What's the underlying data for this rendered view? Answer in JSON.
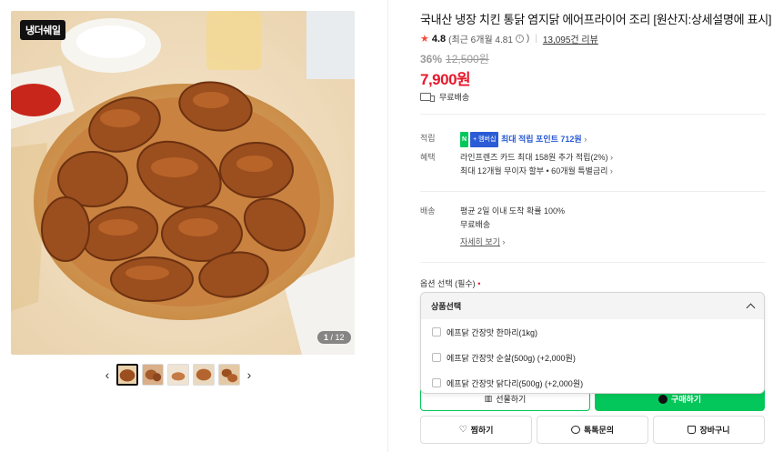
{
  "gallery": {
    "brand_badge": "냉더쉐일",
    "counter_current": "1",
    "counter_total": "12",
    "counter_separator": " / "
  },
  "product": {
    "title": "국내산 냉장 치킨 통닭 염지닭 에어프라이어 조리 [원산지:상세설명에 표시]",
    "rating": "4.8",
    "rating_sub": "(최근 6개월 4.81",
    "review_count": "13,095건 리뷰",
    "discount_rate": "36%",
    "original_price": "12,500원",
    "sale_price": "7,900원",
    "shipping_label": "무료배송"
  },
  "benefits": {
    "points_label": "적립",
    "npay_n": "N",
    "npay_plus": "+ 멤버십",
    "points_text": "최대 적립 포인트 712원",
    "benefit_label": "혜택",
    "benefit_line1": "라인프렌즈 카드 최대 158원 추가 적립(2%)",
    "benefit_line2": "최대 12개월 무이자 할부 • 60개월 특별금리",
    "delivery_label": "배송",
    "delivery_line1": "평균 2일 이내 도착 확률 100%",
    "delivery_line2": "무료배송",
    "detail_link": "자세히 보기"
  },
  "options": {
    "label": "옵션 선택 (필수)",
    "required_mark": "•",
    "dropdown_header": "상품선택",
    "items": [
      {
        "label": "에프닭 간장맛 한마리(1kg)"
      },
      {
        "label": "에프닭 간장맛 순살(500g) (+2,000원)"
      },
      {
        "label": "에프닭 간장맛 닭다리(500g) (+2,000원)"
      }
    ]
  },
  "actions": {
    "gift": "선물하기",
    "buy": "구매하기",
    "wishlist": "찜하기",
    "talk": "톡톡문의",
    "cart": "장바구니"
  },
  "colors": {
    "price_red": "#e8182b",
    "naver_green": "#03c75a",
    "point_blue": "#2b5cd6"
  }
}
